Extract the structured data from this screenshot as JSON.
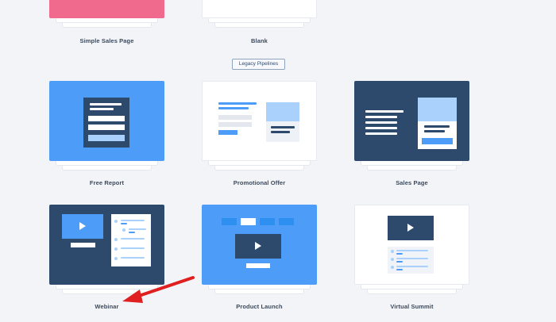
{
  "top_row": [
    {
      "label": "Simple Sales Page",
      "color": "#f06a8e"
    },
    {
      "label": "Blank",
      "color": "#ffffff"
    }
  ],
  "legacy_button": "Legacy Pipelines",
  "row2": [
    {
      "label": "Free Report"
    },
    {
      "label": "Promotional Offer"
    },
    {
      "label": "Sales Page"
    }
  ],
  "row3": [
    {
      "label": "Webinar"
    },
    {
      "label": "Product Launch"
    },
    {
      "label": "Virtual Summit"
    }
  ],
  "annotation": {
    "arrow_color": "#e02020"
  },
  "colors": {
    "blue": "#4d9cf7",
    "navy": "#2d4a6c",
    "light_blue": "#a9d1fb",
    "pink": "#f06a8e"
  }
}
